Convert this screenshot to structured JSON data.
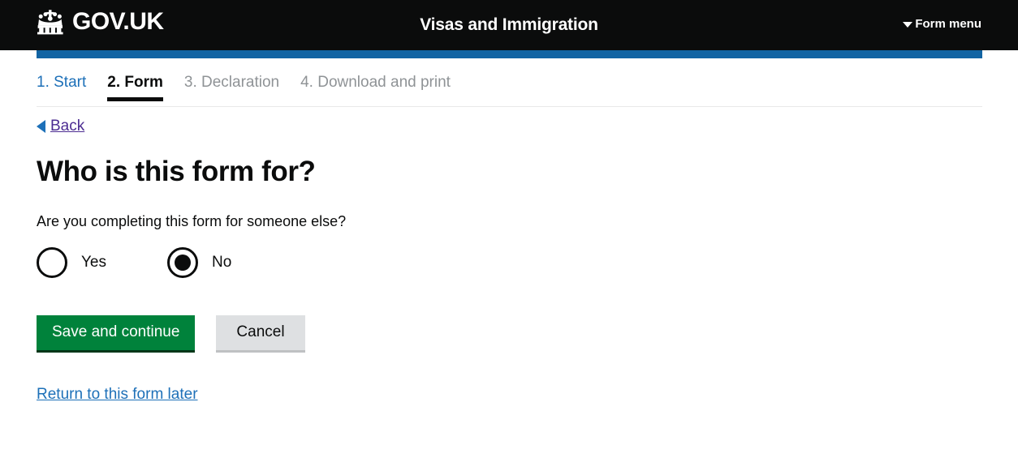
{
  "header": {
    "brand_text": "GOV.UK",
    "crown_icon": "crown-icon",
    "service_name": "Visas and Immigration",
    "form_menu_label": "Form menu",
    "form_menu_icon": "chevron-down-icon",
    "background_color": "#0b0c0c",
    "accent_bar_color": "#1264a3"
  },
  "steps": [
    {
      "label": "1. Start",
      "state": "link"
    },
    {
      "label": "2. Form",
      "state": "current"
    },
    {
      "label": "3. Declaration",
      "state": "muted"
    },
    {
      "label": "4. Download and print",
      "state": "muted"
    }
  ],
  "back": {
    "label": "Back",
    "icon": "caret-left-icon",
    "color": "#4c2c92"
  },
  "main": {
    "title": "Who is this form for?",
    "question": "Are you completing this form for someone else?",
    "radios": [
      {
        "label": "Yes",
        "selected": false
      },
      {
        "label": "No",
        "selected": true
      }
    ]
  },
  "actions": {
    "primary_label": "Save and continue",
    "secondary_label": "Cancel",
    "primary_color": "#00823b",
    "secondary_color": "#dee0e2"
  },
  "footer": {
    "return_link_label": "Return to this form later",
    "link_color": "#1d70b8"
  }
}
